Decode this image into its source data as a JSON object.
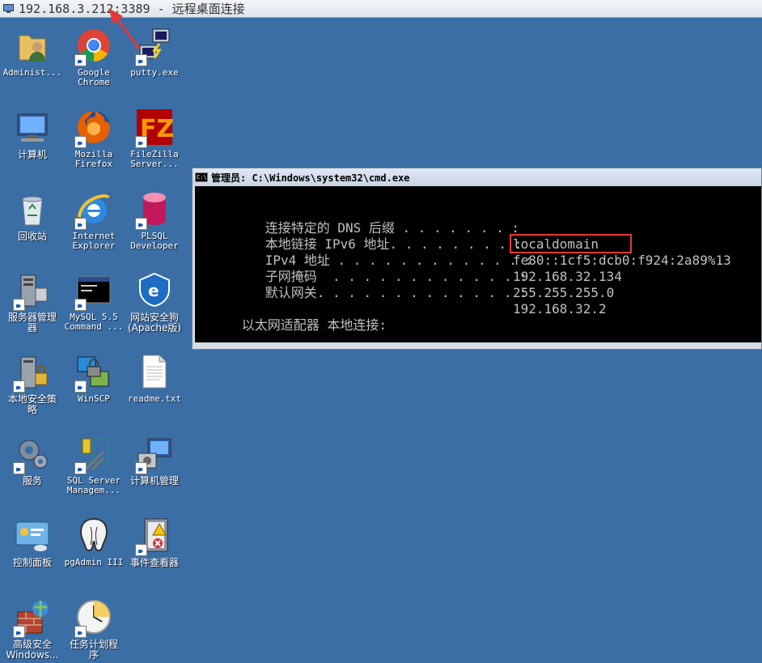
{
  "rdp": {
    "title": "192.168.3.212:3389 - 远程桌面连接"
  },
  "colors": {
    "desktop": "#3a6ea5",
    "annotation": "#e53935",
    "cmd_bg": "#000000",
    "cmd_text": "#c0c0c0"
  },
  "desktop_icons": [
    {
      "label": "Administ...",
      "icon": "user-folder-icon"
    },
    {
      "label": "Google\nChrome",
      "icon": "chrome-icon"
    },
    {
      "label": "putty.exe",
      "icon": "putty-icon"
    },
    {
      "label": "计算机",
      "icon": "computer-icon"
    },
    {
      "label": "Mozilla\nFirefox",
      "icon": "firefox-icon"
    },
    {
      "label": "FileZilla\nServer...",
      "icon": "filezilla-icon"
    },
    {
      "label": "回收站",
      "icon": "recycle-bin-icon"
    },
    {
      "label": "Internet\nExplorer",
      "icon": "ie-icon"
    },
    {
      "label": "PLSQL\nDeveloper",
      "icon": "plsql-icon"
    },
    {
      "label": "服务器管理\n器",
      "icon": "server-manager-icon"
    },
    {
      "label": "MySQL 5.5\nCommand ...",
      "icon": "mysql-cmd-icon"
    },
    {
      "label": "网站安全狗\n(Apache版)",
      "icon": "safedog-icon"
    },
    {
      "label": "本地安全策\n略",
      "icon": "local-security-icon"
    },
    {
      "label": "WinSCP",
      "icon": "winscp-icon"
    },
    {
      "label": "readme.txt",
      "icon": "text-file-icon"
    },
    {
      "label": "服务",
      "icon": "services-gear-icon"
    },
    {
      "label": "SQL Server\nManagem...",
      "icon": "sql-server-icon"
    },
    {
      "label": "计算机管理",
      "icon": "computer-management-icon"
    },
    {
      "label": "控制面板",
      "icon": "control-panel-icon"
    },
    {
      "label": "pgAdmin III",
      "icon": "pgadmin-icon"
    },
    {
      "label": "事件查看器",
      "icon": "event-viewer-icon"
    },
    {
      "label": "高级安全\nWindows...",
      "icon": "firewall-icon"
    },
    {
      "label": "任务计划程\n序",
      "icon": "task-scheduler-icon"
    }
  ],
  "cmd": {
    "title": "管理员: C:\\Windows\\system32\\cmd.exe",
    "lines": [
      {
        "label": "   连接特定的 DNS 后缀 . . . . . . . :",
        "value": "localdomain"
      },
      {
        "label": "   本地链接 IPv6 地址. . . . . . . . :",
        "value": "fe80::1cf5:dcb0:f924:2a89%13"
      },
      {
        "label": "   IPv4 地址 . . . . . . . . . . . . :",
        "value": "192.168.32.134"
      },
      {
        "label": "   子网掩码  . . . . . . . . . . . . :",
        "value": "255.255.255.0"
      },
      {
        "label": "   默认网关. . . . . . . . . . . . . :",
        "value": "192.168.32.2"
      },
      {
        "label": "以太网适配器 本地连接:",
        "value": ""
      }
    ]
  }
}
